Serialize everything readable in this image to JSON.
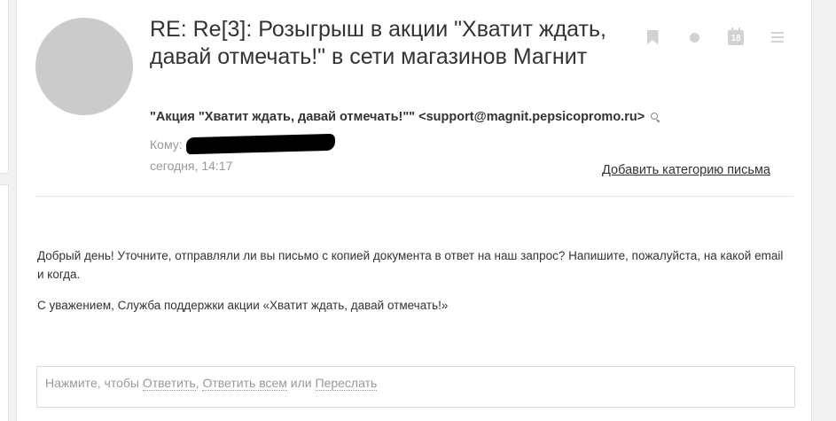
{
  "message": {
    "subject": "RE: Re[3]: Розыгрыш в акции \"Хватит ждать, давай отмечать!\" в сети магазинов Магнит",
    "sender": "\"Акция \"Хватит ждать, давай отмечать!\"\" <support@magnit.pepsicopromo.ru>",
    "to_label": "Кому:",
    "date": "сегодня, 14:17",
    "add_category": "Добавить категорию письма",
    "body": [
      "Добрый день! Уточните, отправляли ли вы письмо с копией документа в ответ на наш запрос? Напишите, пожалуйста,  на какой email и когда.",
      "С уважением, Служба поддержки акции «Хватит ждать, давай отмечать!»"
    ]
  },
  "toolbar": {
    "calendar_day": "18",
    "icons": [
      "bookmark-icon",
      "dot-icon",
      "calendar-icon",
      "menu-icon"
    ]
  },
  "reply": {
    "prefix": "Нажмите, чтобы",
    "reply": "Ответить",
    "sep1": ",",
    "reply_all": "Ответить всем",
    "or": "или",
    "forward": "Переслать"
  },
  "colors": {
    "avatar": "#cbcbcb",
    "icons": "#d2d2d2",
    "text": "#333333",
    "muted": "#999999"
  }
}
